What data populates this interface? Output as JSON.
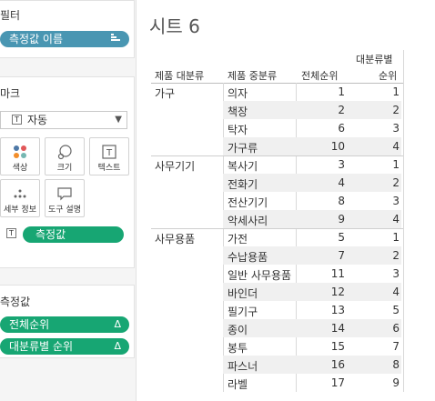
{
  "filters": {
    "title": "필터",
    "pill_label": "측정값 이름"
  },
  "marks": {
    "title": "마크",
    "type_label": "자동",
    "buttons": [
      {
        "label": "색상",
        "icon": "color-dots-icon"
      },
      {
        "label": "크기",
        "icon": "size-icon"
      },
      {
        "label": "텍스트",
        "icon": "text-icon"
      },
      {
        "label": "세부 정보",
        "icon": "detail-icon"
      },
      {
        "label": "도구 설명",
        "icon": "tooltip-icon"
      }
    ],
    "text_pill": "측정값"
  },
  "measures": {
    "title": "측정값",
    "items": [
      {
        "label": "전체순위",
        "delta": "Δ"
      },
      {
        "label": "대분류별 순위",
        "delta": "Δ"
      }
    ]
  },
  "sheet": {
    "title": "시트 6",
    "headers": {
      "category": "제품 대분류",
      "subcategory": "제품 중분류",
      "overall_rank": "전체순위",
      "category_rank_line1": "대분류별",
      "category_rank_line2": "순위"
    },
    "groups": [
      {
        "category": "가구",
        "rows": [
          {
            "name": "의자",
            "overall": "1",
            "rank": "1"
          },
          {
            "name": "책장",
            "overall": "2",
            "rank": "2"
          },
          {
            "name": "탁자",
            "overall": "6",
            "rank": "3"
          },
          {
            "name": "가구류",
            "overall": "10",
            "rank": "4"
          }
        ]
      },
      {
        "category": "사무기기",
        "rows": [
          {
            "name": "복사기",
            "overall": "3",
            "rank": "1"
          },
          {
            "name": "전화기",
            "overall": "4",
            "rank": "2"
          },
          {
            "name": "전산기기",
            "overall": "8",
            "rank": "3"
          },
          {
            "name": "악세사리",
            "overall": "9",
            "rank": "4"
          }
        ]
      },
      {
        "category": "사무용품",
        "rows": [
          {
            "name": "가전",
            "overall": "5",
            "rank": "1"
          },
          {
            "name": "수납용품",
            "overall": "7",
            "rank": "2"
          },
          {
            "name": "일반 사무용품",
            "overall": "11",
            "rank": "3"
          },
          {
            "name": "바인더",
            "overall": "12",
            "rank": "4"
          },
          {
            "name": "필기구",
            "overall": "13",
            "rank": "5"
          },
          {
            "name": "종이",
            "overall": "14",
            "rank": "6"
          },
          {
            "name": "봉투",
            "overall": "15",
            "rank": "7"
          },
          {
            "name": "파스너",
            "overall": "16",
            "rank": "8"
          },
          {
            "name": "라벨",
            "overall": "17",
            "rank": "9"
          }
        ]
      }
    ]
  },
  "colors": {
    "filter_pill": "#4996b2",
    "measure_pill": "#17a673",
    "row_band": "#f0f0f0"
  }
}
